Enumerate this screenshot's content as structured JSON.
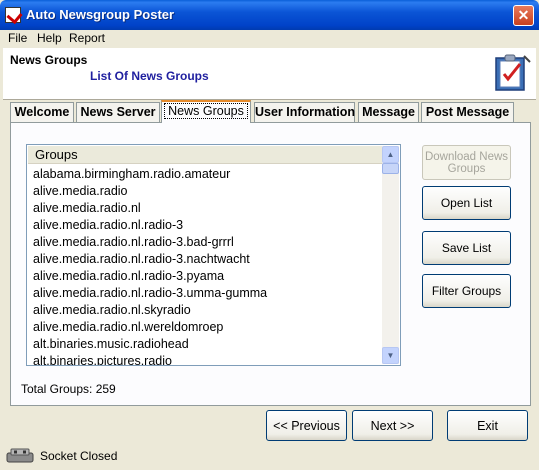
{
  "window": {
    "title": "Auto Newsgroup Poster",
    "close_glyph": "✕"
  },
  "menu": [
    "File",
    "Help",
    "Report"
  ],
  "header": {
    "title": "News Groups",
    "subtitle": "List Of News Groups",
    "icon": "checklist-icon"
  },
  "tabs": [
    {
      "label": "Welcome",
      "active": false
    },
    {
      "label": "News Server",
      "active": false
    },
    {
      "label": "News Groups",
      "active": true
    },
    {
      "label": "User Information",
      "active": false
    },
    {
      "label": "Message",
      "active": false
    },
    {
      "label": "Post Message",
      "active": false
    }
  ],
  "groups_list": {
    "column_header": "Groups",
    "items": [
      "alabama.birmingham.radio.amateur",
      "alive.media.radio",
      "alive.media.radio.nl",
      "alive.media.radio.nl.radio-3",
      "alive.media.radio.nl.radio-3.bad-grrrl",
      "alive.media.radio.nl.radio-3.nachtwacht",
      "alive.media.radio.nl.radio-3.pyama",
      "alive.media.radio.nl.radio-3.umma-gumma",
      "alive.media.radio.nl.skyradio",
      "alive.media.radio.nl.wereldomroep",
      "alt.binaries.music.radiohead",
      "alt.binaries.pictures.radio"
    ]
  },
  "side_buttons": {
    "download": "Download News Groups",
    "open": "Open List",
    "save": "Save List",
    "filter": "Filter Groups"
  },
  "total_groups": "Total Groups: 259",
  "nav_buttons": {
    "previous": "<< Previous",
    "next": "Next >>",
    "exit": "Exit"
  },
  "status": {
    "text": "Socket Closed",
    "icon": "socket-icon"
  },
  "colors": {
    "title_bar": "#0b55d6",
    "header_subtitle": "#1f1f9f",
    "active_tab_accent": "#e68b2c"
  }
}
